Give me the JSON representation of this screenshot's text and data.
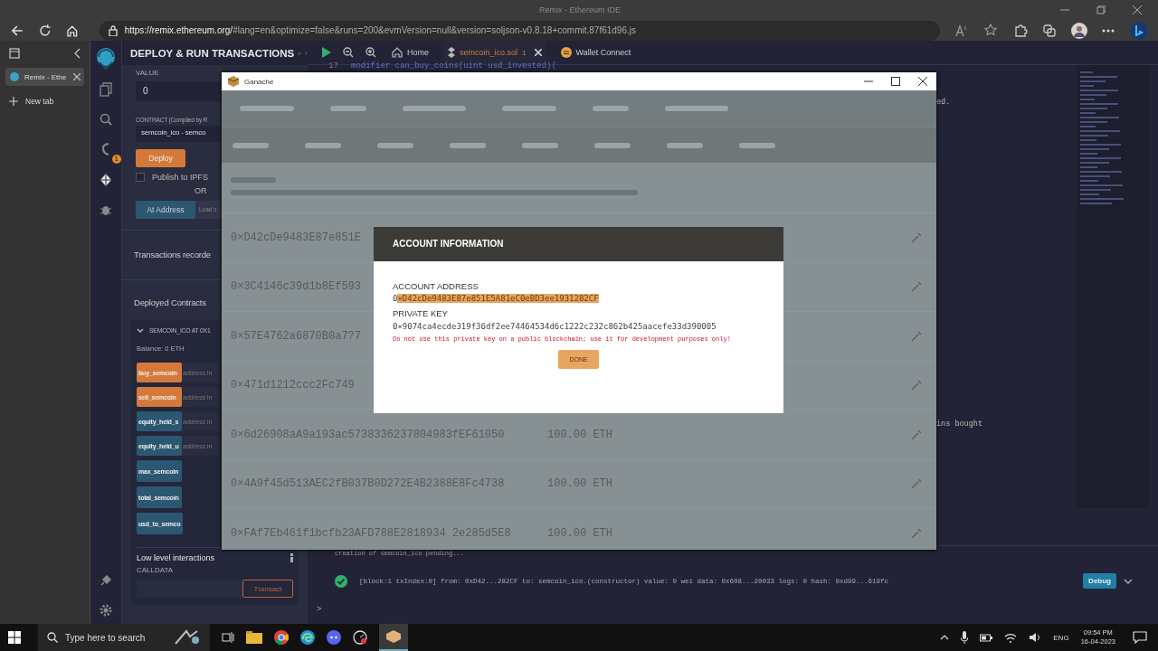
{
  "browser": {
    "window_title": "Remix - Ethereum IDE",
    "url_host": "https://remix.ethereum.org/",
    "url_rest": "#lang=en&optimize=false&runs=200&evmVersion=null&version=soljson-v0.8.18+commit.87f61d96.js",
    "tabs": [
      {
        "label": "Remix - Ethe",
        "selected": true
      }
    ],
    "new_tab": "New tab"
  },
  "side_panel": {
    "title": "DEPLOY & RUN TRANSACTIONS",
    "value_label": "VALUE",
    "value": "0",
    "contract_label": "CONTRACT (Compiled by R",
    "contract_value": "semcoin_ico - semco",
    "deploy": "Deploy",
    "publish": {
      "label": "Publish to IPFS",
      "checked": false
    },
    "or": "OR",
    "at_address": "At Address",
    "load": "Load c",
    "transactions": "Transactions recorde",
    "deployed": "Deployed Contracts",
    "instance": {
      "name": "SEMCOIN_ICO AT 0X1",
      "expanded": true,
      "balance": "Balance: 0 ETH",
      "functions": [
        {
          "label": "buy_semcoin",
          "kind": "transact",
          "hint": "address in"
        },
        {
          "label": "sell_semcoin",
          "kind": "transact",
          "hint": "address in"
        },
        {
          "label": "equity_held_s",
          "kind": "call",
          "hint": "address in"
        },
        {
          "label": "equity_held_u",
          "kind": "call",
          "hint": "address in"
        },
        {
          "label": "max_semcoin",
          "kind": "call"
        },
        {
          "label": "total_semcoin",
          "kind": "call"
        },
        {
          "label": "usd_to_semco",
          "kind": "call"
        }
      ]
    },
    "low_level": "Low level interactions",
    "calldata": "CALLDATA",
    "transact": "Transact"
  },
  "icon_panel": {
    "badge": "1"
  },
  "editor": {
    "tabs": [
      {
        "kind": "home",
        "label": "Home",
        "selected": false
      },
      {
        "kind": "file",
        "label": "semcoin_ico.sol",
        "badge": "1",
        "selected": true
      },
      {
        "kind": "plugin",
        "label": "Wallet Connect",
        "selected": false
      }
    ],
    "line_number": "17",
    "code": "modifier can_buy_coins(uint usd_invested){",
    "fragments": [
      "ed.",
      "ins bought"
    ]
  },
  "terminal": {
    "pending": "creation of semcoin_ico pending...",
    "log": "[block:1 txIndex:0] from: 0xD42...282CF to: semcoin_ico.(constructor) value: 0 wei data: 0x608...20033 logs: 0 hash: 0xd99...619fc",
    "debug": "Debug",
    "prompt": ">"
  },
  "ganache": {
    "title": "Ganache",
    "accounts": [
      {
        "address": "0×D42cDe9483E87e851E"
      },
      {
        "address": "0×3C4146c39d1b8Ef593"
      },
      {
        "address": "0×57E4762a6870B0a7?7"
      },
      {
        "address": "0×471d1212ccc2Fc749"
      },
      {
        "address": "0×6d26908aA9a193ac5738336237804983fEF61050",
        "balance": "100.00 ETH"
      },
      {
        "address": "0×4A9f45d513AEC2fB037B0D272E4B2388E8Fc4738",
        "balance": "100.00 ETH"
      },
      {
        "address": "0×FAf7Eb461f1bcfb23AFD788E2818934 2e285d5E8",
        "balance": "100.00 ETH"
      }
    ],
    "dialog": {
      "title": "ACCOUNT INFORMATION",
      "address_label": "ACCOUNT ADDRESS",
      "address": [
        {
          "text": "0",
          "selected": false
        },
        {
          "text": "×D42cDe9483E87e851E5A81eC0eBD3ee1931282CF",
          "selected": true
        }
      ],
      "key_label": "PRIVATE KEY",
      "private_key": "0×9074ca4ecde319f36df2ee74464534d6c1222c232c862b425aacefe33d390005",
      "warning": "Do not use this private key on a public blockchain; use it for development purposes only!",
      "done": "DONE"
    }
  },
  "taskbar": {
    "search": "Type here to search",
    "language": "ENG",
    "time": "09:54 PM",
    "date": "16-04-2023"
  }
}
